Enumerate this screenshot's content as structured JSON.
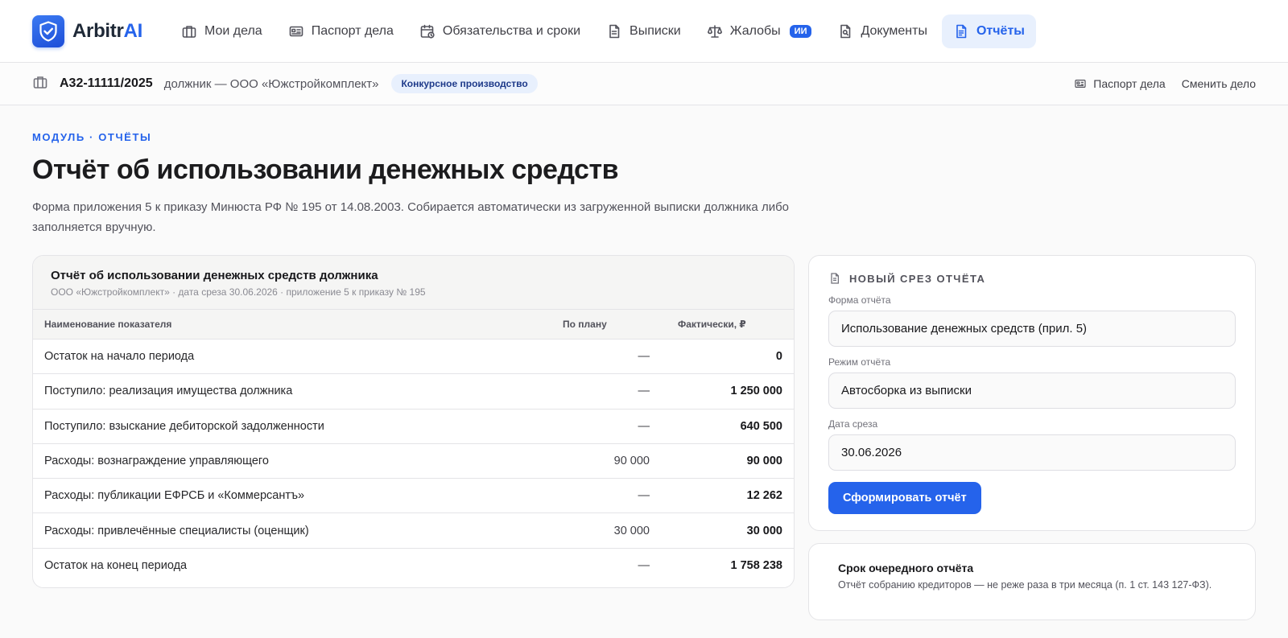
{
  "app": {
    "name_a": "Arbitr",
    "name_b": "AI"
  },
  "nav": [
    {
      "label": "Мои дела",
      "icon": "briefcase-icon"
    },
    {
      "label": "Паспорт дела",
      "icon": "id-card-icon"
    },
    {
      "label": "Обязательства и сроки",
      "icon": "calendar-clock-icon"
    },
    {
      "label": "Выписки",
      "icon": "document-lines-icon"
    },
    {
      "label": "Жалобы",
      "icon": "scales-icon",
      "badge": "ИИ"
    },
    {
      "label": "Документы",
      "icon": "document-search-icon"
    },
    {
      "label": "Отчёты",
      "icon": "report-icon",
      "active": true
    }
  ],
  "case": {
    "number": "А32-11111/2025",
    "debtor": "должник — ООО «Южстройкомплект»",
    "status": "Конкурсное производство",
    "passport_link": "Паспорт дела",
    "change_link": "Сменить дело"
  },
  "page": {
    "eyebrow": "МОДУЛЬ · ОТЧЁТЫ",
    "title": "Отчёт об использовании денежных средств",
    "description": "Форма приложения 5 к приказу Минюста РФ № 195 от 14.08.2003. Собирается автоматически из загруженной выписки должника либо заполняется вручную."
  },
  "report": {
    "title": "Отчёт об использовании денежных средств должника",
    "subtitle": "ООО «Южстройкомплект» · дата среза 30.06.2026 · приложение 5 к приказу № 195",
    "columns": {
      "name": "Наименование показателя",
      "plan": "По плану",
      "fact": "Фактически, ₽"
    },
    "rows": [
      {
        "name": "Остаток на начало периода",
        "plan": "—",
        "fact": "0"
      },
      {
        "name": "Поступило: реализация имущества должника",
        "plan": "—",
        "fact": "1 250 000"
      },
      {
        "name": "Поступило: взыскание дебиторской задолженности",
        "plan": "—",
        "fact": "640 500"
      },
      {
        "name": "Расходы: вознаграждение управляющего",
        "plan": "90 000",
        "fact": "90 000"
      },
      {
        "name": "Расходы: публикации ЕФРСБ и «Коммерсантъ»",
        "plan": "—",
        "fact": "12 262"
      },
      {
        "name": "Расходы: привлечённые специалисты (оценщик)",
        "plan": "30 000",
        "fact": "30 000"
      },
      {
        "name": "Остаток на конец периода",
        "plan": "—",
        "fact": "1 758 238"
      }
    ]
  },
  "form": {
    "title": "НОВЫЙ СРЕЗ ОТЧЁТА",
    "form_label": "Форма отчёта",
    "form_value": "Использование денежных средств (прил. 5)",
    "mode_label": "Режим отчёта",
    "mode_value": "Автосборка из выписки",
    "date_label": "Дата среза",
    "date_value": "30.06.2026",
    "submit_label": "Сформировать отчёт"
  },
  "due": {
    "title": "Срок очередного отчёта",
    "text": "Отчёт собранию кредиторов — не реже раза в три месяца (п. 1 ст. 143 127-ФЗ)."
  },
  "colors": {
    "accent": "#2563eb",
    "accent_bg": "#e8f0fd",
    "badge_text": "#1e3a8a"
  }
}
